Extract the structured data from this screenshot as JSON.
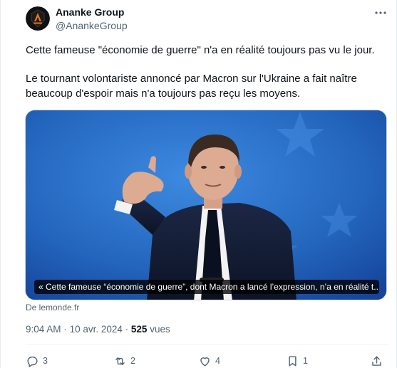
{
  "author": {
    "name": "Ananke Group",
    "handle": "@AnankeGroup"
  },
  "tweet": {
    "paragraph_1": "Cette fameuse \"économie de guerre\" n'a en réalité toujours pas vu le jour.",
    "paragraph_2": "Le tournant volontariste annoncé par Macron sur l'Ukraine a fait naître beaucoup d'espoir mais n'a toujours pas reçu les moyens."
  },
  "media": {
    "caption": "« Cette fameuse “économie de guerre”, dont Macron a lancé l’expression, n’a en réalité t...",
    "source": "De lemonde.fr"
  },
  "meta": {
    "time": "9:04 AM",
    "separator_1": "·",
    "date": "10 avr. 2024",
    "separator_2": "·",
    "views_count": "525",
    "views_label": "vues"
  },
  "actions": {
    "replies": "3",
    "reposts": "2",
    "likes": "4",
    "bookmarks": "1"
  },
  "icons": {
    "avatar": "ananke-logo-icon",
    "more": "more-dots-icon",
    "reply": "reply-icon",
    "repost": "repost-icon",
    "like": "heart-icon",
    "bookmark": "bookmark-icon",
    "share": "share-icon"
  },
  "colors": {
    "text": "#0f1419",
    "secondary": "#536471",
    "logo_orange": "#e8721c"
  }
}
